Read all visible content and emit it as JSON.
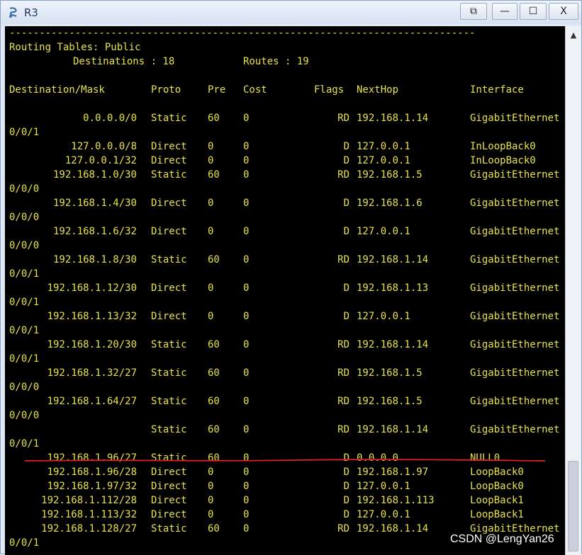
{
  "window": {
    "title": "R3",
    "buttons": {
      "restore": "⧉",
      "minimize": "—",
      "maximize": "☐",
      "close": "X"
    }
  },
  "terminal": {
    "separator": "------------------------------------------------------------------------------",
    "header_line1": "Routing Tables: Public",
    "destinations_label": "Destinations : 18",
    "routes_label": "Routes : 19",
    "columns": [
      "Destination/Mask",
      "Proto",
      "Pre",
      "Cost",
      "Flags",
      "NextHop",
      "Interface"
    ],
    "routes": [
      {
        "dest": "0.0.0.0/0",
        "proto": "Static",
        "pre": "60",
        "cost": "0",
        "flags": "RD",
        "nexthop": "192.168.1.14",
        "iface": "GigabitEthernet",
        "wrap": "0/0/1"
      },
      {
        "dest": "127.0.0.0/8",
        "proto": "Direct",
        "pre": "0",
        "cost": "0",
        "flags": "D",
        "nexthop": "127.0.0.1",
        "iface": "InLoopBack0",
        "wrap": ""
      },
      {
        "dest": "127.0.0.1/32",
        "proto": "Direct",
        "pre": "0",
        "cost": "0",
        "flags": "D",
        "nexthop": "127.0.0.1",
        "iface": "InLoopBack0",
        "wrap": ""
      },
      {
        "dest": "192.168.1.0/30",
        "proto": "Static",
        "pre": "60",
        "cost": "0",
        "flags": "RD",
        "nexthop": "192.168.1.5",
        "iface": "GigabitEthernet",
        "wrap": "0/0/0"
      },
      {
        "dest": "192.168.1.4/30",
        "proto": "Direct",
        "pre": "0",
        "cost": "0",
        "flags": "D",
        "nexthop": "192.168.1.6",
        "iface": "GigabitEthernet",
        "wrap": "0/0/0"
      },
      {
        "dest": "192.168.1.6/32",
        "proto": "Direct",
        "pre": "0",
        "cost": "0",
        "flags": "D",
        "nexthop": "127.0.0.1",
        "iface": "GigabitEthernet",
        "wrap": "0/0/0"
      },
      {
        "dest": "192.168.1.8/30",
        "proto": "Static",
        "pre": "60",
        "cost": "0",
        "flags": "RD",
        "nexthop": "192.168.1.14",
        "iface": "GigabitEthernet",
        "wrap": "0/0/1"
      },
      {
        "dest": "192.168.1.12/30",
        "proto": "Direct",
        "pre": "0",
        "cost": "0",
        "flags": "D",
        "nexthop": "192.168.1.13",
        "iface": "GigabitEthernet",
        "wrap": "0/0/1"
      },
      {
        "dest": "192.168.1.13/32",
        "proto": "Direct",
        "pre": "0",
        "cost": "0",
        "flags": "D",
        "nexthop": "127.0.0.1",
        "iface": "GigabitEthernet",
        "wrap": "0/0/1"
      },
      {
        "dest": "192.168.1.20/30",
        "proto": "Static",
        "pre": "60",
        "cost": "0",
        "flags": "RD",
        "nexthop": "192.168.1.14",
        "iface": "GigabitEthernet",
        "wrap": "0/0/1"
      },
      {
        "dest": "192.168.1.32/27",
        "proto": "Static",
        "pre": "60",
        "cost": "0",
        "flags": "RD",
        "nexthop": "192.168.1.5",
        "iface": "GigabitEthernet",
        "wrap": "0/0/0"
      },
      {
        "dest": "192.168.1.64/27",
        "proto": "Static",
        "pre": "60",
        "cost": "0",
        "flags": "RD",
        "nexthop": "192.168.1.5",
        "iface": "GigabitEthernet",
        "wrap": "0/0/0"
      },
      {
        "dest": "",
        "proto": "Static",
        "pre": "60",
        "cost": "0",
        "flags": "RD",
        "nexthop": "192.168.1.14",
        "iface": "GigabitEthernet",
        "wrap": "0/0/1"
      },
      {
        "dest": "192.168.1.96/27",
        "proto": "Static",
        "pre": "60",
        "cost": "0",
        "flags": "D",
        "nexthop": "0.0.0.0",
        "iface": "NULL0",
        "wrap": ""
      },
      {
        "dest": "192.168.1.96/28",
        "proto": "Direct",
        "pre": "0",
        "cost": "0",
        "flags": "D",
        "nexthop": "192.168.1.97",
        "iface": "LoopBack0",
        "wrap": ""
      },
      {
        "dest": "192.168.1.97/32",
        "proto": "Direct",
        "pre": "0",
        "cost": "0",
        "flags": "D",
        "nexthop": "127.0.0.1",
        "iface": "LoopBack0",
        "wrap": ""
      },
      {
        "dest": "192.168.1.112/28",
        "proto": "Direct",
        "pre": "0",
        "cost": "0",
        "flags": "D",
        "nexthop": "192.168.1.113",
        "iface": "LoopBack1",
        "wrap": ""
      },
      {
        "dest": "192.168.1.113/32",
        "proto": "Direct",
        "pre": "0",
        "cost": "0",
        "flags": "D",
        "nexthop": "127.0.0.1",
        "iface": "LoopBack1",
        "wrap": ""
      },
      {
        "dest": "192.168.1.128/27",
        "proto": "Static",
        "pre": "60",
        "cost": "0",
        "flags": "RD",
        "nexthop": "192.168.1.14",
        "iface": "GigabitEthernet",
        "wrap": "0/0/1"
      }
    ],
    "highlight_color": "#e0201c",
    "text_color": "#e8e24a"
  },
  "watermark": "CSDN @LengYan26"
}
